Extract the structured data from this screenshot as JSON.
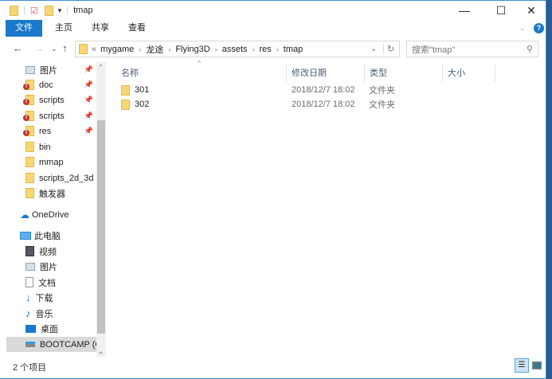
{
  "window": {
    "title": "tmap",
    "minimize": "—",
    "maximize": "☐",
    "close": "✕",
    "help": "?"
  },
  "ribbon": {
    "tabs": [
      "文件",
      "主页",
      "共享",
      "查看"
    ]
  },
  "address": {
    "overflow": "«",
    "crumbs": [
      "mygame",
      "龙途",
      "Flying3D",
      "assets",
      "res",
      "tmap"
    ],
    "search_placeholder": "搜索\"tmap\""
  },
  "sidebar": {
    "quick": [
      {
        "label": "图片",
        "pinned": true
      },
      {
        "label": "doc",
        "pinned": true,
        "warn": true
      },
      {
        "label": "scripts",
        "pinned": true,
        "warn": true
      },
      {
        "label": "scripts",
        "pinned": true,
        "warn": true
      },
      {
        "label": "res",
        "pinned": true,
        "warn": true
      },
      {
        "label": "bin"
      },
      {
        "label": "mmap"
      },
      {
        "label": "scripts_2d_3d"
      },
      {
        "label": "触发器"
      }
    ],
    "onedrive": "OneDrive",
    "pc": "此电脑",
    "pc_items": [
      "视频",
      "图片",
      "文档",
      "下载",
      "音乐",
      "桌面",
      "BOOTCAMP (C"
    ]
  },
  "columns": [
    "名称",
    "修改日期",
    "类型",
    "大小"
  ],
  "files": [
    {
      "name": "301",
      "date": "2018/12/7 18:02",
      "type": "文件夹"
    },
    {
      "name": "302",
      "date": "2018/12/7 18:02",
      "type": "文件夹"
    }
  ],
  "status": "2 个项目"
}
